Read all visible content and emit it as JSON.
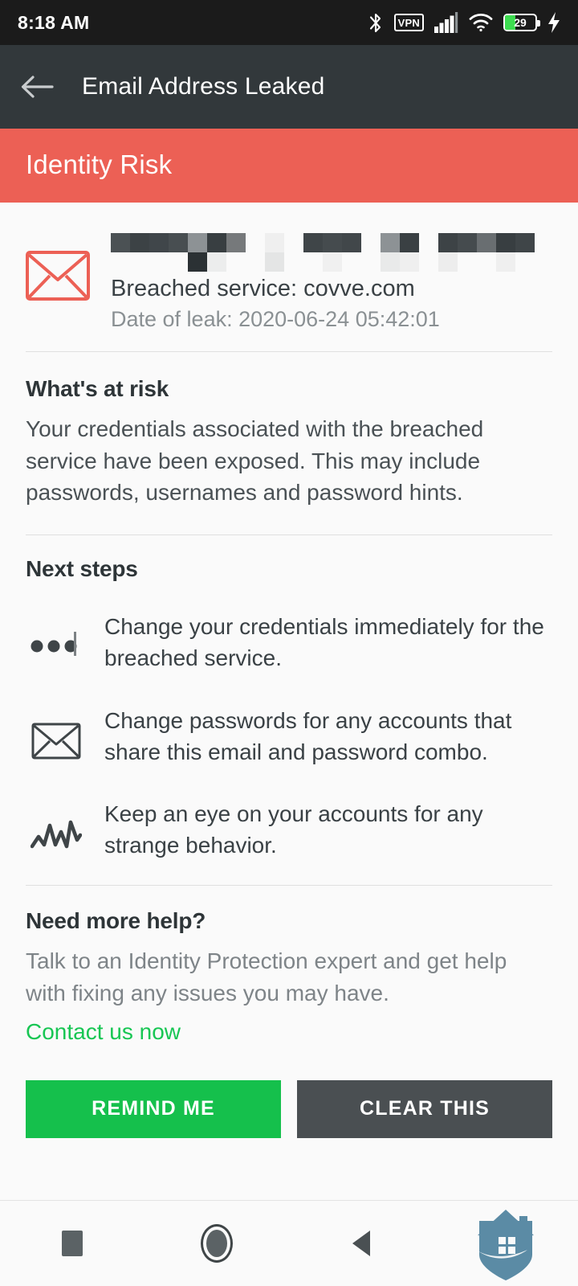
{
  "status_bar": {
    "time": "8:18 AM",
    "icons": [
      "bluetooth-icon",
      "vpn-icon",
      "cellular-signal-icon",
      "wifi-icon",
      "battery-icon",
      "charging-bolt-icon"
    ],
    "vpn_label": "VPN",
    "battery_percent": "29"
  },
  "app_bar": {
    "back_label": "Back",
    "title": "Email Address Leaked"
  },
  "risk_banner": {
    "title": "Identity Risk",
    "color": "#EC6055"
  },
  "breach": {
    "email_redacted": "[redacted email address]",
    "service": "Breached service: covve.com",
    "date": "Date of leak: 2020-06-24 05:42:01"
  },
  "whats_at_risk": {
    "title": "What's at risk",
    "body": "Your credentials associated with the breached service have been exposed. This may include passwords, usernames and password hints."
  },
  "next_steps": {
    "title": "Next steps",
    "items": [
      {
        "icon": "password-dots-icon",
        "text": "Change your credentials immediately for the breached service."
      },
      {
        "icon": "envelope-icon",
        "text": "Change passwords for any accounts that share this email and password combo."
      },
      {
        "icon": "activity-zigzag-icon",
        "text": "Keep an eye on your accounts for any strange behavior."
      }
    ]
  },
  "help": {
    "title": "Need more help?",
    "body": "Talk to an Identity Protection expert and get help with fixing any issues you may have.",
    "link": "Contact us now",
    "link_color": "#17C653"
  },
  "actions": {
    "remind": "REMIND ME",
    "remind_color": "#15C04C",
    "clear": "CLEAR THIS",
    "clear_color": "#4A4F52"
  },
  "nav_bar": {
    "recents_label": "Recents",
    "home_label": "Home",
    "back_label": "Back",
    "app_logo_label": "house-shield-logo"
  }
}
